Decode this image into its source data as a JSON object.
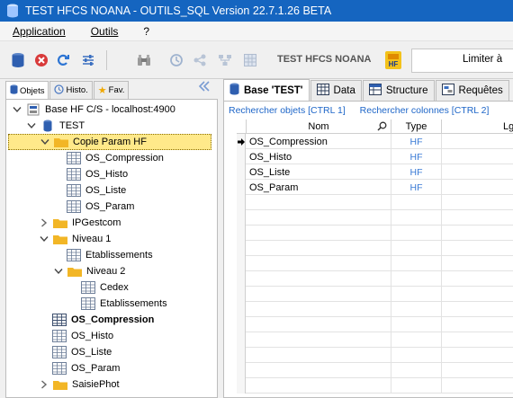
{
  "window": {
    "title": "TEST HFCS NOANA - OUTILS_SQL Version 22.7.1.26 BETA"
  },
  "menu": {
    "application": "Application",
    "outils": "Outils",
    "help": "?"
  },
  "toolbar": {
    "db_label": "TEST HFCS NOANA",
    "limit_label": "Limiter à"
  },
  "left_tabs": {
    "objets": "Objets",
    "histo": "Histo.",
    "fav": "Fav."
  },
  "tree": {
    "root": "Base HF C/S - localhost:4900",
    "test": "TEST",
    "copie": "Copie Param HF",
    "copie_children": [
      "OS_Compression",
      "OS_Histo",
      "OS_Liste",
      "OS_Param"
    ],
    "ipgestcom": "IPGestcom",
    "niveau1": "Niveau 1",
    "etablissements": "Etablissements",
    "niveau2": "Niveau 2",
    "cedex": "Cedex",
    "etablissements2": "Etablissements",
    "os_compression": "OS_Compression",
    "os_histo": "OS_Histo",
    "os_liste": "OS_Liste",
    "os_param": "OS_Param",
    "saisiephot": "SaisiePhot"
  },
  "right_tabs": {
    "base": "Base 'TEST'",
    "data": "Data",
    "structure": "Structure",
    "requetes": "Requêtes"
  },
  "links": {
    "objects": "Rechercher objets [CTRL 1]",
    "columns": "Rechercher colonnes [CTRL 2]"
  },
  "grid": {
    "headers": {
      "nom": "Nom",
      "type": "Type",
      "lg": "Lg"
    },
    "rows": [
      {
        "nom": "OS_Compression",
        "type": "HF"
      },
      {
        "nom": "OS_Histo",
        "type": "HF"
      },
      {
        "nom": "OS_Liste",
        "type": "HF"
      },
      {
        "nom": "OS_Param",
        "type": "HF"
      }
    ]
  },
  "colors": {
    "titlebar": "#1565c0",
    "selection": "#ffe98a",
    "folder": "#f2b626",
    "link": "#1e66c8",
    "type_text": "#3a7bd5"
  }
}
